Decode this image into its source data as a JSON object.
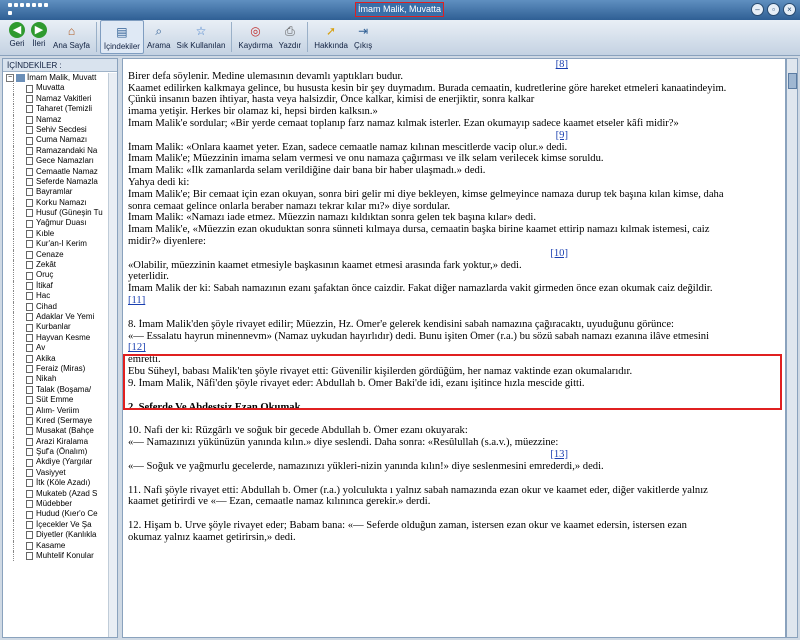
{
  "window": {
    "title": "İmam Malik, Muvatta"
  },
  "toolbar": {
    "items": [
      {
        "label": "Geri",
        "icon": "back-arrow-icon"
      },
      {
        "label": "İleri",
        "icon": "forward-arrow-icon"
      },
      {
        "label": "Ana Sayfa",
        "icon": "home-icon"
      },
      {
        "label": "İçindekiler",
        "icon": "contents-icon"
      },
      {
        "label": "Arama",
        "icon": "search-icon"
      },
      {
        "label": "Sık Kullanılan",
        "icon": "star-icon"
      },
      {
        "label": "Kaydırma",
        "icon": "scroll-icon"
      },
      {
        "label": "Yazdır",
        "icon": "printer-icon"
      },
      {
        "label": "Hakkında",
        "icon": "info-icon"
      },
      {
        "label": "Çıkış",
        "icon": "exit-icon"
      }
    ]
  },
  "sidebar": {
    "header": "İÇİNDEKİLER :",
    "root": "İmam Malik, Muvatt",
    "items": [
      "Muvatta",
      "Namaz Vakitleri",
      "Taharet (Temizli",
      "Namaz",
      "Sehiv Secdesi",
      "Cuma Namazı",
      "Ramazandaki Na",
      "Gece Namazları",
      "Cemaatle Namaz",
      "Seferde Namazla",
      "Bayramlar",
      "Korku Namazı",
      "Husuf (Güneşin Tu",
      "Yağmur Duası",
      "Kıble",
      "Kur'an-I Kerim",
      "Cenaze",
      "Zekât",
      "Oruç",
      "İtikaf",
      "Hac",
      "Cihad",
      "Adaklar Ve Yemi",
      "Kurbanlar",
      "Hayvan Kesme",
      "Av",
      "Akika",
      "Feraiz (Miras)",
      "Nikah",
      "Talak (Boşama/",
      "Süt Emme",
      "Alım- Veriim",
      "Kıred (Sermaye",
      "Musakat (Bahçe",
      "Arazi Kiralama",
      "Şuf'a (Önalım)",
      "Akdiye (Yargılar",
      "Vasiyyet",
      "İtk (Köle Azadı)",
      "Mukateb (Azad S",
      "Müdebber",
      "Hudud (Kıer'o Ce",
      "İçecekler Ve Şa",
      "Diyetler (Kanlıkla",
      "Kasame",
      "Muhtelif Konular"
    ]
  },
  "content": {
    "lines": [
      {
        "t": "[8]",
        "fn": true,
        "align": "right"
      },
      {
        "t": "Birer defa söylenir. Medine ulemasının devamlı yaptıkları budur."
      },
      {
        "t": "Kaamet edilirken kalkmaya gelince, bu hususta kesin bir şey duymadım. Burada cemaatin, kudretlerine göre hareket etmeleri kanaatindeyim."
      },
      {
        "t": "Çünkü insanın bazen ihtiyar, hasta veya halsizdir, Önce kalkar, kimisi de enerjiktir, sonra kalkar"
      },
      {
        "t": "imama yetişir. Herkes bir olamaz ki, hepsi birden kalksın.»"
      },
      {
        "t": "İmam Malik'e sordular; «Bir yerde cemaat toplanıp farz namaz kılmak isterler. Ezan okumayıp sadece kaamet etseler kâfi midir?»"
      },
      {
        "t": "[9]",
        "fn": true,
        "align": "right"
      },
      {
        "t": "İmam Malik: «Onlara kaamet yeter. Ezan, sadece cemaatle namaz kılınan mescitlerde vacip olur.» dedi."
      },
      {
        "t": "İmam Malik'e; Müezzinin imama selam vermesi ve onu namaza çağırması ve ilk selam verilecek kimse soruldu."
      },
      {
        "t": "İmam Malik: «İlk zamanlarda selam verildiğine dair bana bir haber ulaşmadı.» dedi."
      },
      {
        "t": "Yahya dedi ki:"
      },
      {
        "t": "İmam Malik'e; Bir cemaat için ezan okuyan, sonra biri gelir mi diye bekleyen, kimse gelmeyince namaza durup tek başına kılan kimse, daha"
      },
      {
        "t": "sonra cemaat gelince onlarla beraber namazı tekrar kılar mı?» diye sordular."
      },
      {
        "t": "İmam Malik: «Namazı iade etmez. Müezzin namazı kıldıktan sonra gelen tek başına kılar» dedi."
      },
      {
        "t": "İmam Malik'e, «Müezzin ezan okuduktan sonra sünneti kılmaya dursa, cemaatin başka birine kaamet ettirip namazı kılmak istemesi, caiz"
      },
      {
        "t": "midir?» diyenlere:"
      },
      {
        "t": "[10]",
        "fn": true,
        "align": "right"
      },
      {
        "t": "«Olabilir, müezzinin kaamet etmesiyle başkasının kaamet etmesi arasında fark yoktur,» dedi."
      },
      {
        "t": "yeterlidir."
      },
      {
        "t": "İmam Malik der ki: Sabah namazının ezanı şafaktan önce caizdir. Fakat diğer namazlarda vakit girmeden önce ezan okumak caiz değildir."
      },
      {
        "t": "[11]",
        "fn": true
      },
      {
        "t": "",
        "gap": true
      },
      {
        "t": "8. İmam Malik'den şöyle rivayet edilir; Müezzin, Hz. Ömer'e gelerek kendisini sabah namazına çağıracaktı, uyuduğunu görünce:"
      },
      {
        "t": "«— Essalatu hayrun minennevm» (Namaz uykudan hayırlıdır) dedi. Bunu işiten Ömer (r.a.) bu sözü sabah namazı ezanına ilâve etmesini"
      },
      {
        "t": "[12]",
        "fn": true
      },
      {
        "t": "emretti."
      },
      {
        "t": "Ebu Süheyl, babası Malik'ten şöyle rivayet etti: Güvenilir kişilerden gördüğüm, her namaz vaktinde ezan okumalarıdır."
      },
      {
        "t": "9. İmam Malik, Nâfi'den şöyle rivayet eder: Abdullah b. Ömer Baki'de idi, ezanı işitince hızla mescide gitti."
      },
      {
        "t": "",
        "gap": true
      },
      {
        "t": "2. Seferde Ve Abdestsiz Ezan Okumak",
        "bold": true
      },
      {
        "t": "",
        "gap": true
      },
      {
        "t": "10. Nafi der ki: Rüzgârlı ve soğuk bir gecede Abdullah b. Ömer ezanı okuyarak:"
      },
      {
        "t": "«— Namazınızı yükünüzün yanında kılın.» diye seslendi. Daha sonra: «Resûlullah (s.a.v.), müezzine:"
      },
      {
        "t": "[13]",
        "fn": true,
        "align": "right"
      },
      {
        "t": "«— Soğuk ve yağmurlu gecelerde, namazınızı yükleri-nizin yanında kılın!» diye seslenmesini emrederdi,» dedi."
      },
      {
        "t": "",
        "gap": true
      },
      {
        "t": "11. Nafi şöyle rivayet etti: Abdullah b. Ömer (r.a.) yolculukta ı yalnız sabah namazında ezan okur ve kaamet eder, diğer vakitlerde yalnız"
      },
      {
        "t": "kaamet getirirdi ve «— Ezan, cemaatle namaz kılınınca gerekir.» derdi."
      },
      {
        "t": "",
        "gap": true
      },
      {
        "t": "12. Hişam b. Urve şöyle rivayet eder; Babam bana: «— Seferde olduğun zaman, istersen ezan okur ve kaamet edersin, istersen ezan"
      },
      {
        "t": "okumaz yalnız kaamet getirirsin,» dedi."
      }
    ]
  },
  "colors": {
    "highlight": "#e02020",
    "link": "#1a3fb0",
    "titlebar": "#2f5f94"
  }
}
